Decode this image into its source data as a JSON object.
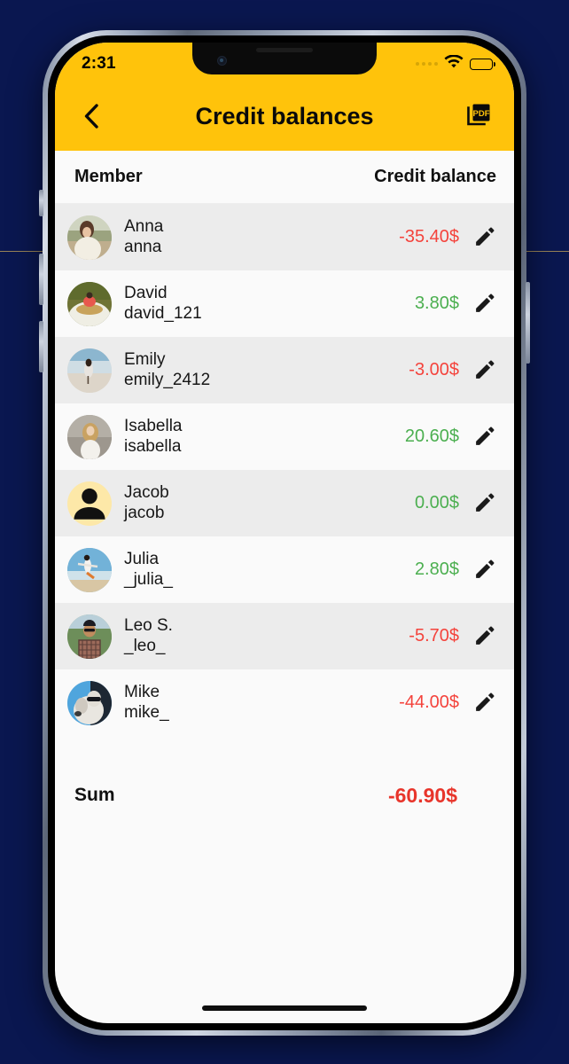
{
  "status_bar": {
    "time": "2:31",
    "cellular_icon": "cellular-dots-icon",
    "wifi_icon": "wifi-icon",
    "battery_icon": "battery-full-icon"
  },
  "app_bar": {
    "back_icon": "chevron-left-icon",
    "title": "Credit balances",
    "export_icon": "pdf-export-icon",
    "export_label": "PDF",
    "background_color": "#FFC30B"
  },
  "table": {
    "headers": {
      "member": "Member",
      "balance": "Credit balance"
    },
    "rows": [
      {
        "name": "Anna",
        "handle": "anna",
        "amount": "-35.40$",
        "sign": "neg",
        "avatar": "photo-woman-beach",
        "edit_icon": "pencil-icon"
      },
      {
        "name": "David",
        "handle": "david_121",
        "amount": "3.80$",
        "sign": "pos",
        "avatar": "photo-man-boat",
        "edit_icon": "pencil-icon"
      },
      {
        "name": "Emily",
        "handle": "emily_2412",
        "amount": "-3.00$",
        "sign": "neg",
        "avatar": "photo-woman-shore",
        "edit_icon": "pencil-icon"
      },
      {
        "name": "Isabella",
        "handle": "isabella",
        "amount": "20.60$",
        "sign": "pos",
        "avatar": "photo-woman-wall",
        "edit_icon": "pencil-icon"
      },
      {
        "name": "Jacob",
        "handle": "jacob",
        "amount": "0.00$",
        "sign": "pos",
        "avatar": "person-placeholder-icon",
        "edit_icon": "pencil-icon"
      },
      {
        "name": "Julia",
        "handle": "_julia_",
        "amount": "2.80$",
        "sign": "pos",
        "avatar": "photo-woman-jump",
        "edit_icon": "pencil-icon"
      },
      {
        "name": "Leo S.",
        "handle": "_leo_",
        "amount": "-5.70$",
        "sign": "neg",
        "avatar": "photo-man-hat",
        "edit_icon": "pencil-icon"
      },
      {
        "name": "Mike",
        "handle": "mike_",
        "amount": "-44.00$",
        "sign": "neg",
        "avatar": "photo-man-dog",
        "edit_icon": "pencil-icon"
      }
    ]
  },
  "summary": {
    "label": "Sum",
    "value": "-60.90$",
    "sign": "neg"
  },
  "colors": {
    "accent": "#FFC30B",
    "negative": "#F4433C",
    "positive": "#4CAF50",
    "sum_negative": "#E8352B",
    "row_odd": "#ECECEC",
    "row_even": "#FAFAFA",
    "page_background": "#0A1750"
  }
}
